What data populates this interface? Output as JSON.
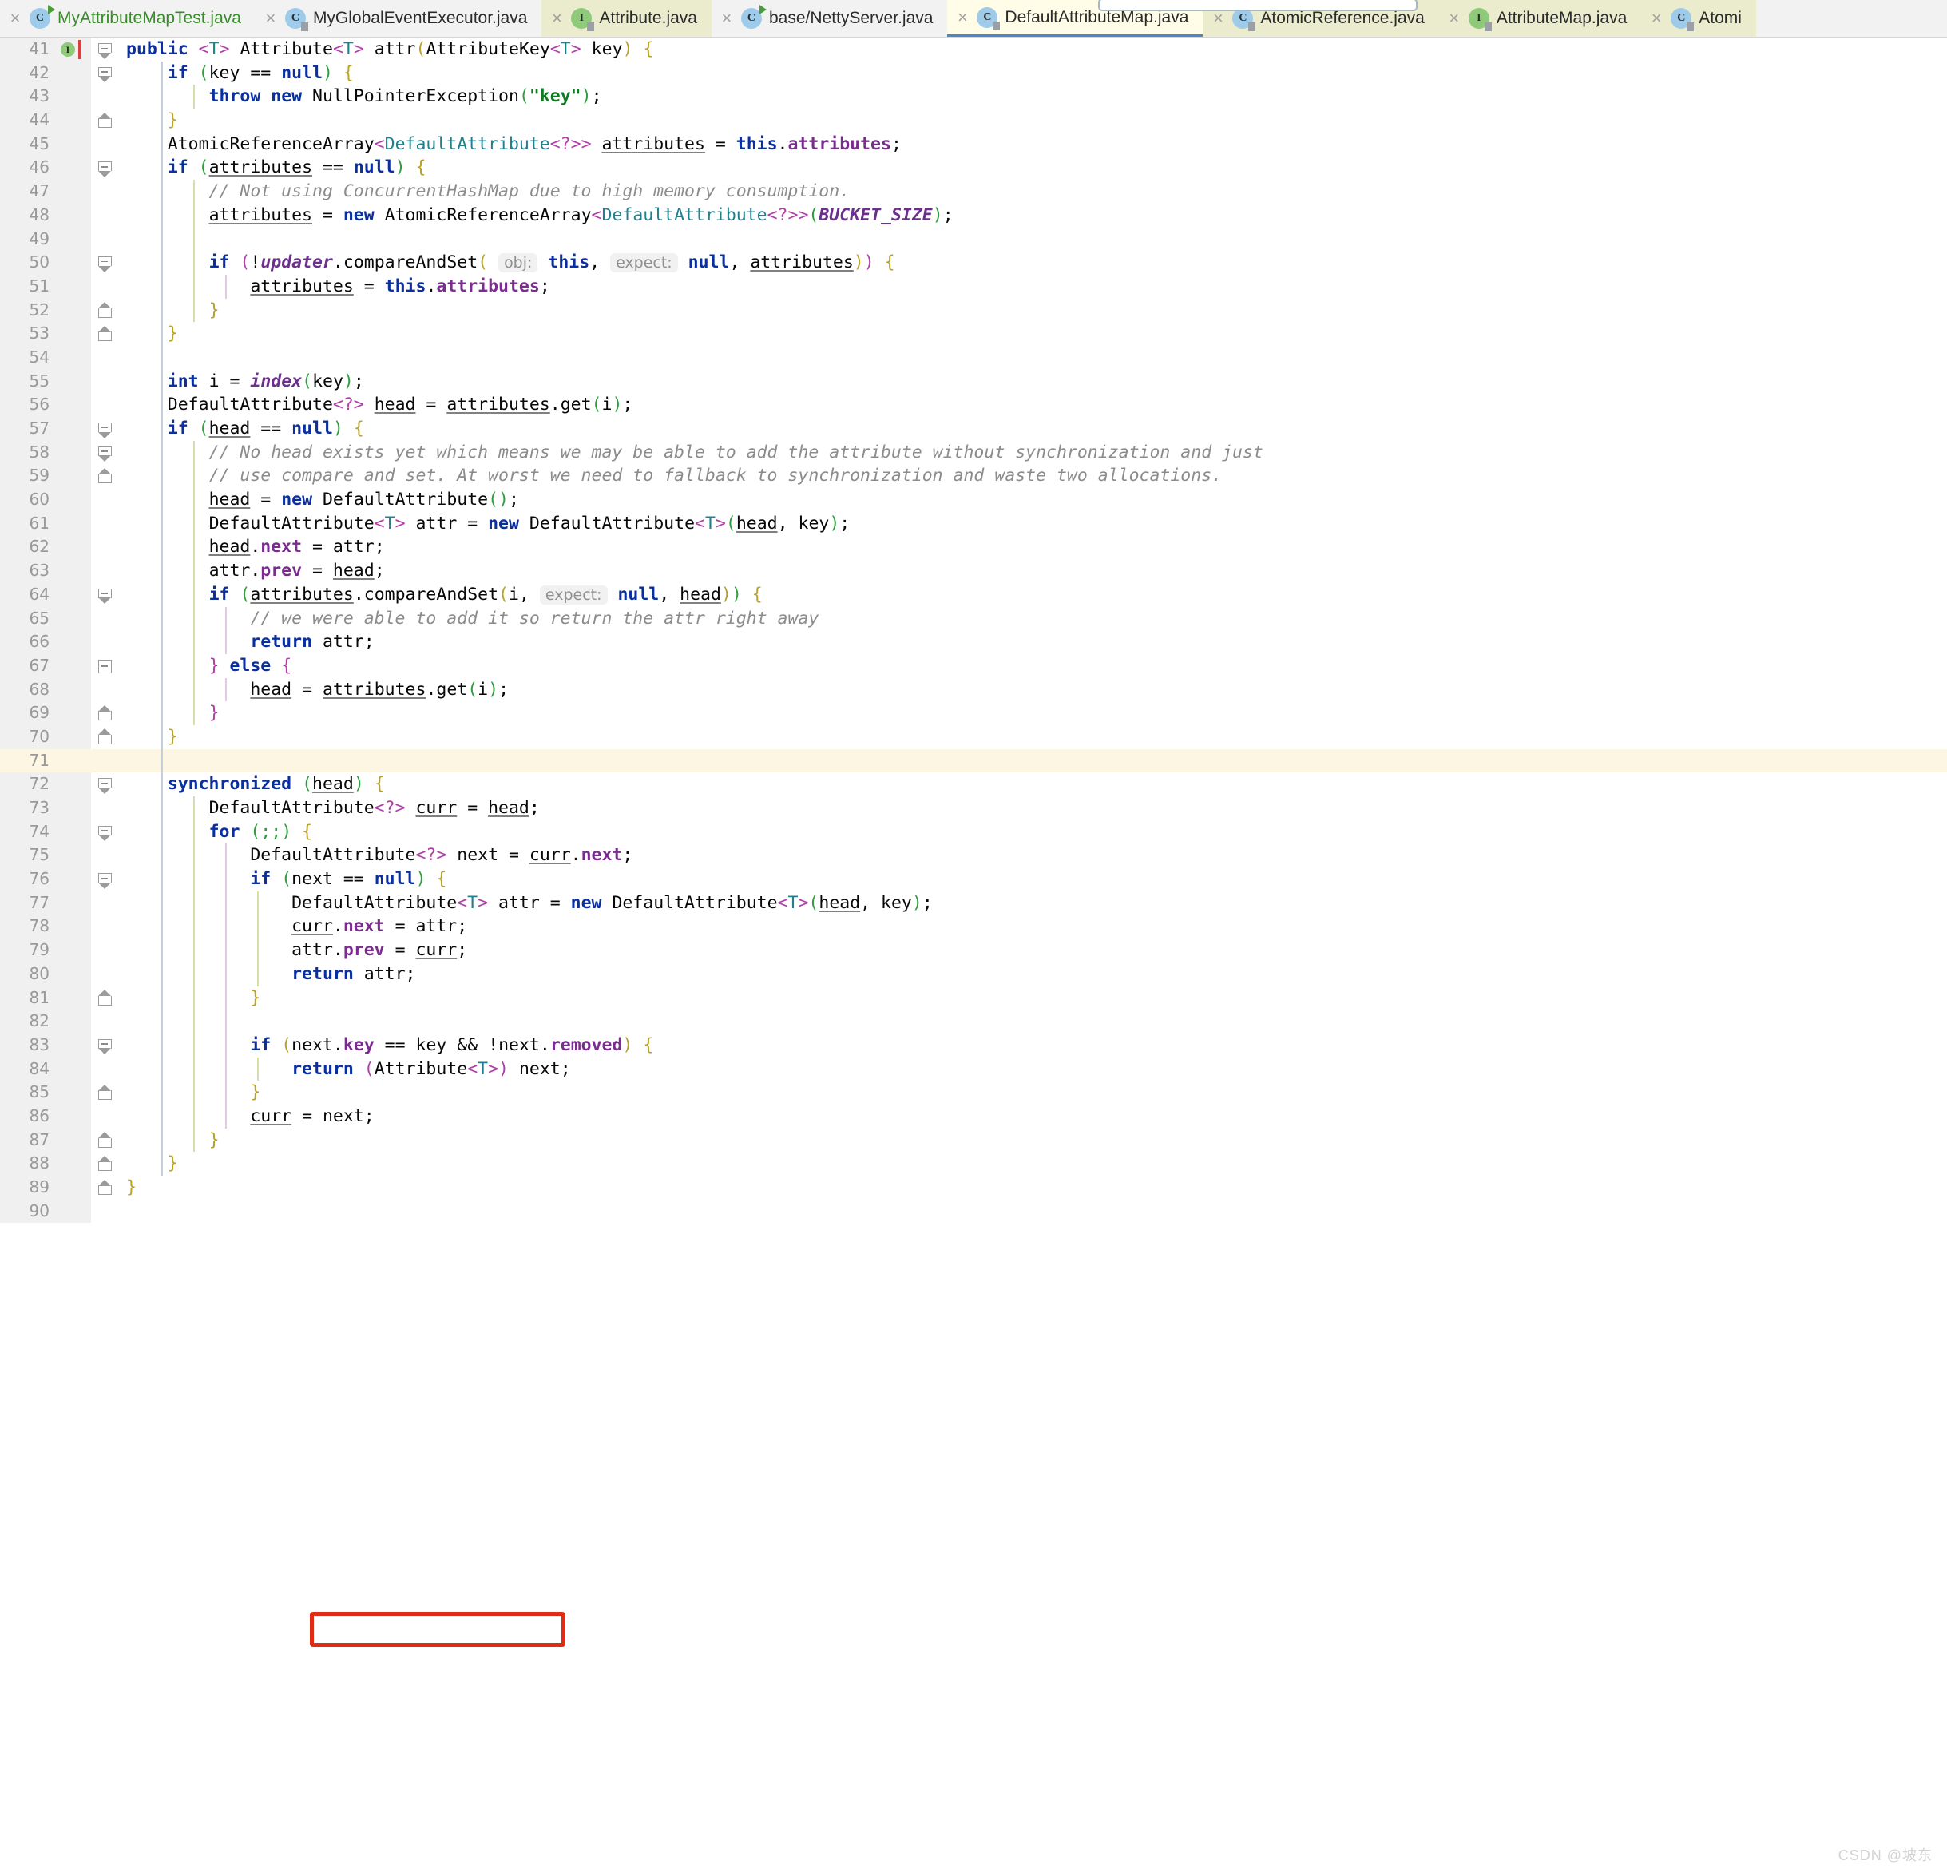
{
  "tabs": [
    {
      "label": "MyAttributeMapTest.java",
      "icon": "java-class-runnable-icon",
      "state": "normal",
      "label_color": "green",
      "has_close": false
    },
    {
      "label": "MyGlobalEventExecutor.java",
      "icon": "java-class-icon",
      "state": "normal",
      "label_color": "default",
      "has_close": true
    },
    {
      "label": "Attribute.java",
      "icon": "java-interface-icon",
      "state": "olive",
      "label_color": "default",
      "has_close": true
    },
    {
      "label": "base/NettyServer.java",
      "icon": "java-class-runnable-icon",
      "state": "normal",
      "label_color": "default",
      "has_close": true
    },
    {
      "label": "DefaultAttributeMap.java",
      "icon": "java-class-icon",
      "state": "active",
      "label_color": "default",
      "has_close": true
    },
    {
      "label": "AtomicReference.java",
      "icon": "java-class-icon",
      "state": "olive",
      "label_color": "default",
      "has_close": true
    },
    {
      "label": "AttributeMap.java",
      "icon": "java-interface-icon",
      "state": "olive",
      "label_color": "default",
      "has_close": true
    },
    {
      "label": "Atomi",
      "icon": "java-class-icon",
      "state": "olive",
      "label_color": "default",
      "has_close": true
    }
  ],
  "editor": {
    "active_file": "DefaultAttributeMap.java",
    "caret_line": 71,
    "first_line": 41,
    "last_line": 90,
    "line_numbers": [
      "41",
      "42",
      "43",
      "44",
      "45",
      "46",
      "47",
      "48",
      "49",
      "50",
      "51",
      "52",
      "53",
      "54",
      "55",
      "56",
      "57",
      "58",
      "59",
      "60",
      "61",
      "62",
      "63",
      "64",
      "65",
      "66",
      "67",
      "68",
      "69",
      "70",
      "71",
      "72",
      "73",
      "74",
      "75",
      "76",
      "77",
      "78",
      "79",
      "80",
      "81",
      "82",
      "83",
      "84",
      "85",
      "86",
      "87",
      "88",
      "89",
      "90"
    ],
    "code_lines": {
      "41": "public <T> Attribute<T> attr(AttributeKey<T> key) {",
      "42": "    if (key == null) {",
      "43": "        throw new NullPointerException(\"key\");",
      "44": "    }",
      "45": "    AtomicReferenceArray<DefaultAttribute<?>> attributes = this.attributes;",
      "46": "    if (attributes == null) {",
      "47": "        // Not using ConcurrentHashMap due to high memory consumption.",
      "48": "        attributes = new AtomicReferenceArray<DefaultAttribute<?>>(BUCKET_SIZE);",
      "49": "",
      "50": "        if (!updater.compareAndSet( obj: this,  expect: null, attributes)) {",
      "51": "            attributes = this.attributes;",
      "52": "        }",
      "53": "    }",
      "54": "",
      "55": "    int i = index(key);",
      "56": "    DefaultAttribute<?> head = attributes.get(i);",
      "57": "    if (head == null) {",
      "58": "        // No head exists yet which means we may be able to add the attribute without synchronization and just",
      "59": "        // use compare and set. At worst we need to fallback to synchronization and waste two allocations.",
      "60": "        head = new DefaultAttribute();",
      "61": "        DefaultAttribute<T> attr = new DefaultAttribute<T>(head, key);",
      "62": "        head.next = attr;",
      "63": "        attr.prev = head;",
      "64": "        if (attributes.compareAndSet(i,  expect: null, head)) {",
      "65": "            // we were able to add it so return the attr right away",
      "66": "            return attr;",
      "67": "        } else {",
      "68": "            head = attributes.get(i);",
      "69": "        }",
      "70": "    }",
      "71": "",
      "72": "    synchronized (head) {",
      "73": "        DefaultAttribute<?> curr = head;",
      "74": "        for (;;) {",
      "75": "            DefaultAttribute<?> next = curr.next;",
      "76": "            if (next == null) {",
      "77": "                DefaultAttribute<T> attr = new DefaultAttribute<T>(head, key);",
      "78": "                curr.next = attr;",
      "79": "                attr.prev = curr;",
      "80": "                return attr;",
      "81": "            }",
      "82": "",
      "83": "            if (next.key == key && !next.removed) {",
      "84": "                return (Attribute<T>) next;",
      "85": "            }",
      "86": "            curr = next;",
      "87": "        }",
      "88": "    }",
      "89": "}",
      "90": ""
    },
    "inlay_hints": [
      {
        "line": 50,
        "text": "obj:"
      },
      {
        "line": 50,
        "text": "expect:"
      },
      {
        "line": 64,
        "text": "expect:"
      }
    ],
    "annotation": {
      "type": "red-rectangle",
      "target_line": 83,
      "target_text": "if (next.key == key && !next.removed) {",
      "color": "#e02b15"
    },
    "gutter_icon_line_41": "implementing-method-icon"
  },
  "watermark": "CSDN @坡东"
}
